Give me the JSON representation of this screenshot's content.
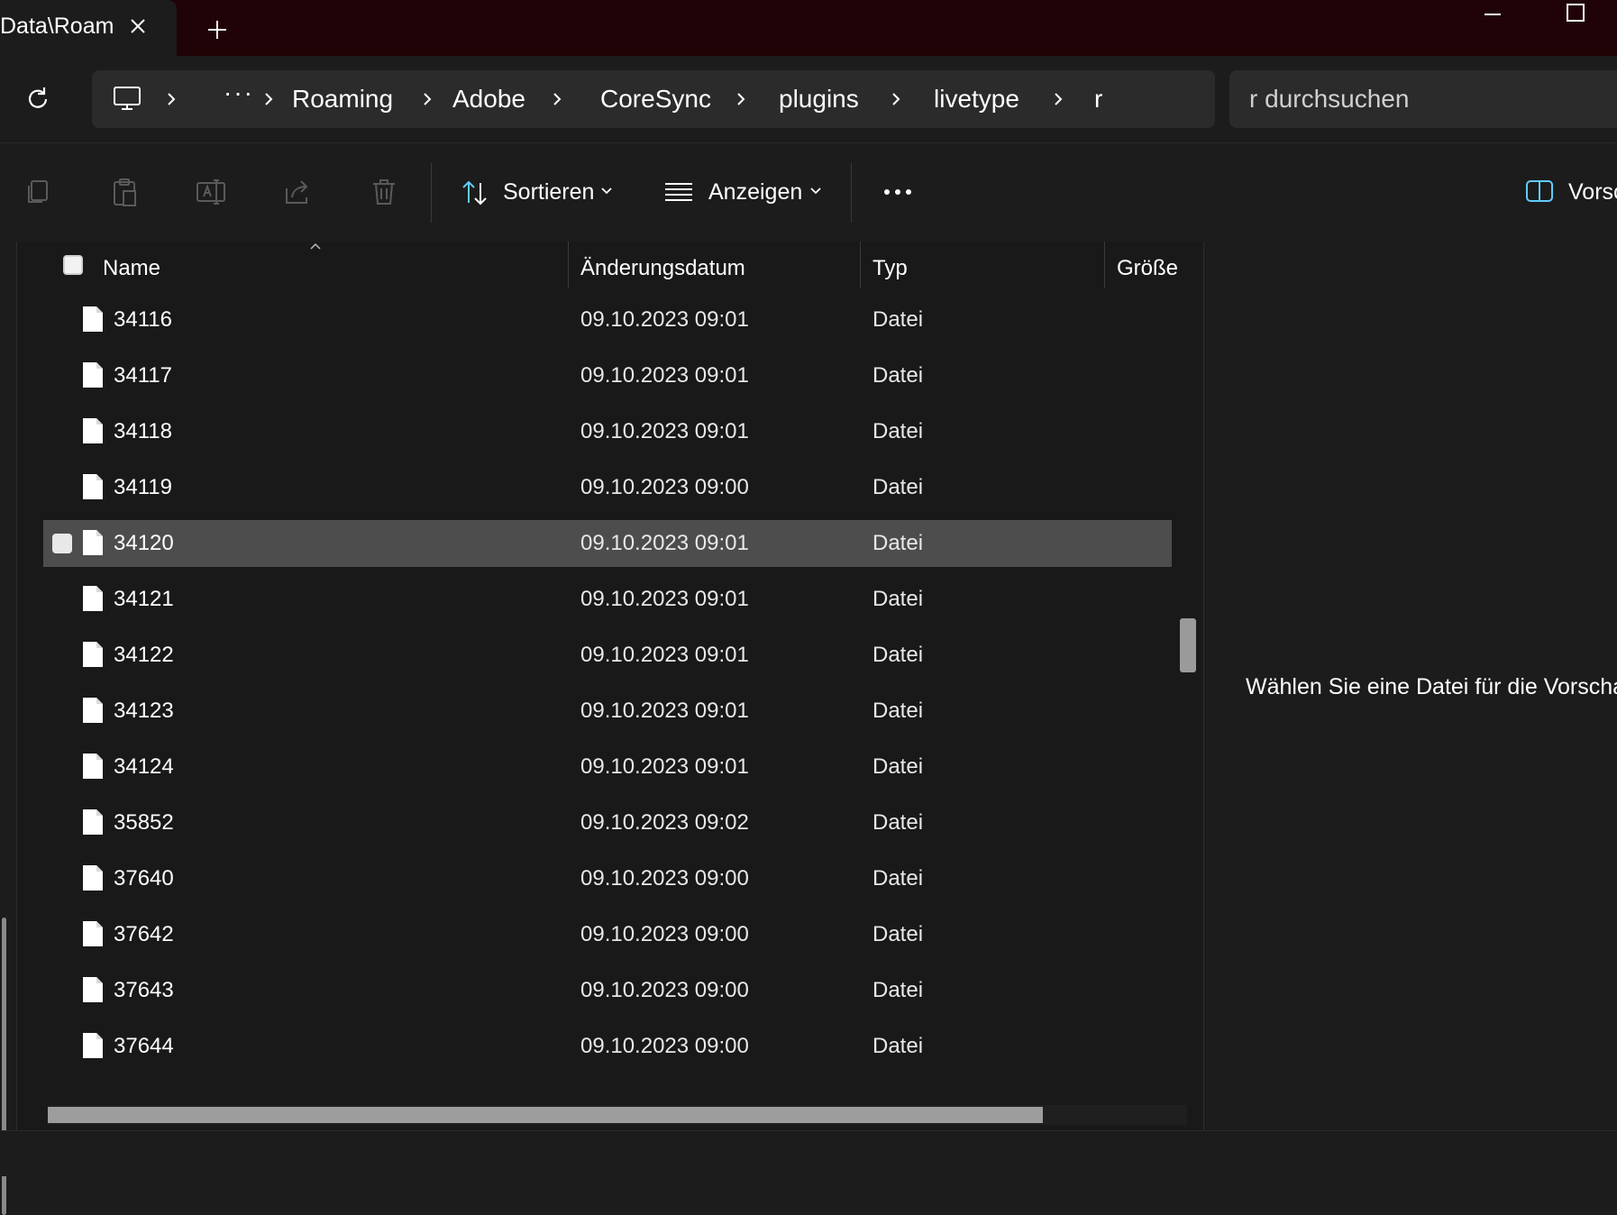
{
  "tab": {
    "title": "Data\\Roam"
  },
  "breadcrumb": {
    "items": [
      "Roaming",
      "Adobe",
      "CoreSync",
      "plugins",
      "livetype",
      "r"
    ],
    "ellipsis": "···"
  },
  "search": {
    "placeholder": "r durchsuchen"
  },
  "toolbar": {
    "sort_label": "Sortieren",
    "view_label": "Anzeigen",
    "preview_label": "Vorsc"
  },
  "columns": {
    "name": "Name",
    "date": "Änderungsdatum",
    "type": "Typ",
    "size": "Größe"
  },
  "files": [
    {
      "name": "34116",
      "date": "09.10.2023 09:01",
      "type": "Datei"
    },
    {
      "name": "34117",
      "date": "09.10.2023 09:01",
      "type": "Datei"
    },
    {
      "name": "34118",
      "date": "09.10.2023 09:01",
      "type": "Datei"
    },
    {
      "name": "34119",
      "date": "09.10.2023 09:00",
      "type": "Datei"
    },
    {
      "name": "34120",
      "date": "09.10.2023 09:01",
      "type": "Datei",
      "selected": true
    },
    {
      "name": "34121",
      "date": "09.10.2023 09:01",
      "type": "Datei"
    },
    {
      "name": "34122",
      "date": "09.10.2023 09:01",
      "type": "Datei"
    },
    {
      "name": "34123",
      "date": "09.10.2023 09:01",
      "type": "Datei"
    },
    {
      "name": "34124",
      "date": "09.10.2023 09:01",
      "type": "Datei"
    },
    {
      "name": "35852",
      "date": "09.10.2023 09:02",
      "type": "Datei"
    },
    {
      "name": "37640",
      "date": "09.10.2023 09:00",
      "type": "Datei"
    },
    {
      "name": "37642",
      "date": "09.10.2023 09:00",
      "type": "Datei"
    },
    {
      "name": "37643",
      "date": "09.10.2023 09:00",
      "type": "Datei"
    },
    {
      "name": "37644",
      "date": "09.10.2023 09:00",
      "type": "Datei"
    }
  ],
  "preview": {
    "message": "Wählen Sie eine Datei für die Vorschau"
  },
  "colors": {
    "titlebar": "#200306",
    "background": "#1c1c1c",
    "selected_row": "#4d4d4d",
    "accent": "#60cdff"
  }
}
